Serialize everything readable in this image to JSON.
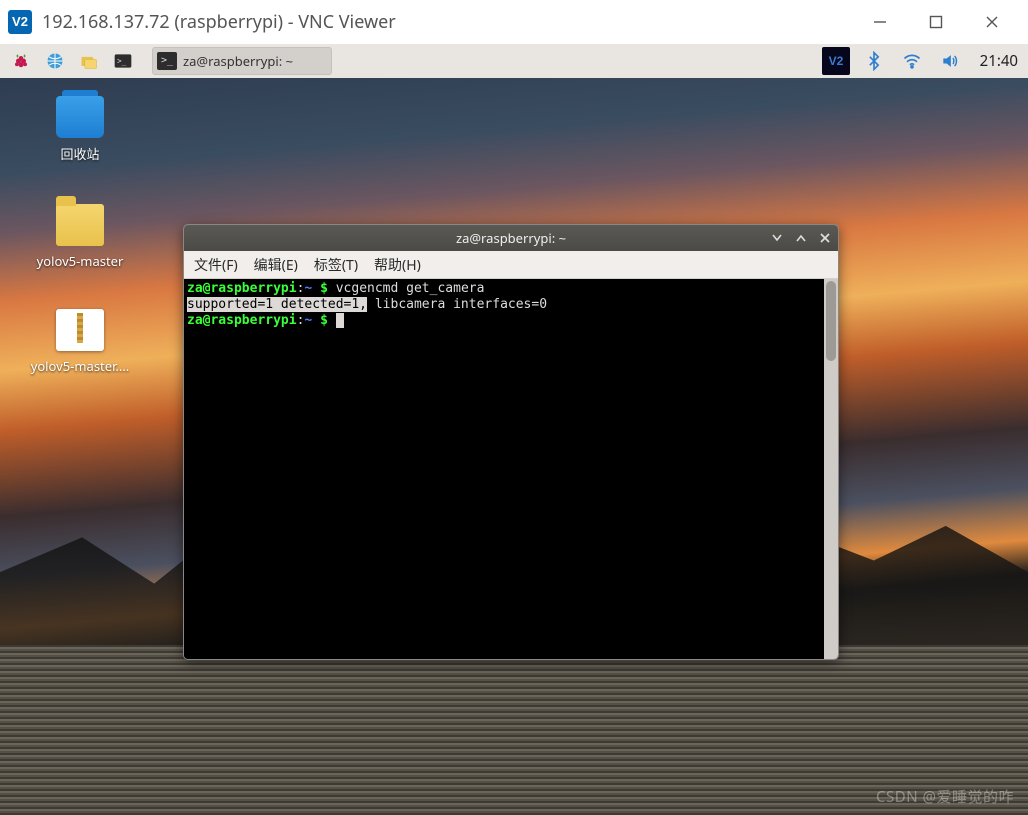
{
  "vnc_window": {
    "logo_text": "V2",
    "title": "192.168.137.72 (raspberrypi) - VNC Viewer"
  },
  "panel": {
    "taskbar_item": "za@raspberrypi: ~",
    "task_icon_label": ">_",
    "clock": "21:40",
    "tray_vnc": "V2"
  },
  "desktop_icons": {
    "trash": "回收站",
    "folder1": "yolov5-master",
    "zip1": "yolov5-master...."
  },
  "terminal": {
    "title": "za@raspberrypi: ~",
    "menu": {
      "file": "文件(F)",
      "edit": "编辑(E)",
      "tabs": "标签(T)",
      "help": "帮助(H)"
    },
    "lines": {
      "p1_user": "za@raspberrypi",
      "p1_sep": ":",
      "p1_path": "~ ",
      "p1_dollar": "$",
      "p1_cmd": " vcgencmd get_camera",
      "out_sel": "supported=1 detected=1,",
      "out_rest": " libcamera interfaces=0",
      "p2_user": "za@raspberrypi",
      "p2_sep": ":",
      "p2_path": "~ ",
      "p2_dollar": "$",
      "cursor": " "
    }
  },
  "watermark": "CSDN @爱睡觉的咋"
}
